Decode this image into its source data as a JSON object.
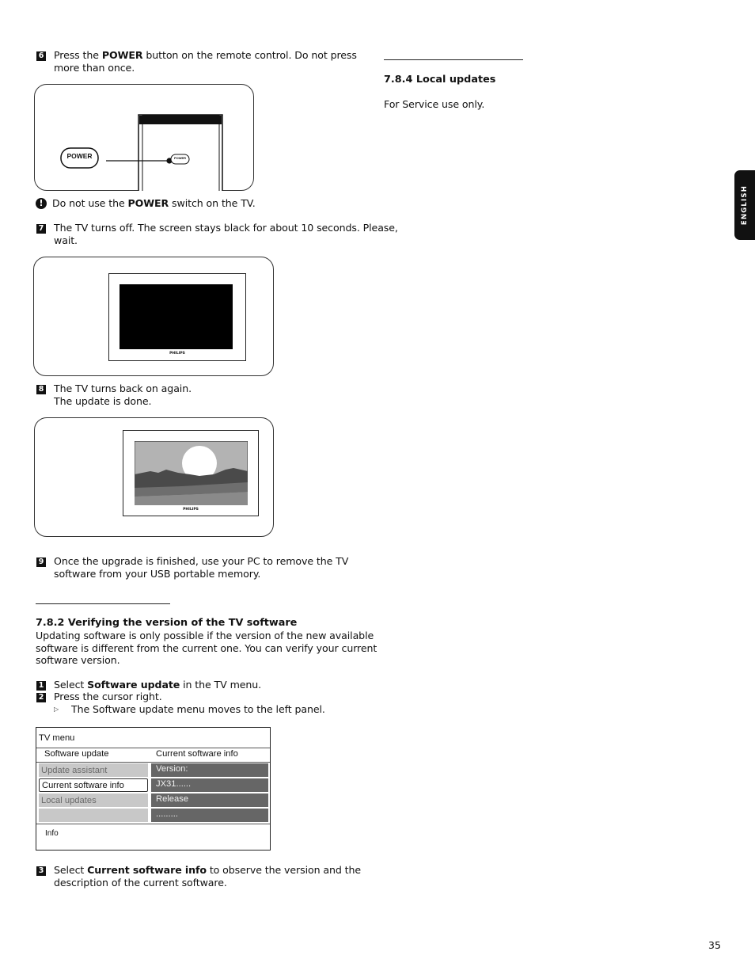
{
  "page_number": "35",
  "side_tab": "ENGLISH",
  "left_column": {
    "step6": {
      "number": "6",
      "text_pre": "Press the ",
      "bold": "POWER",
      "text_post": " button on the remote control. Do not press",
      "line2": "more than once."
    },
    "illustration_remote": {
      "remote_button_label": "POWER",
      "tv_button_label": "POWER"
    },
    "warning": {
      "icon": "exclamation-circle-icon",
      "text_pre": "Do not use the ",
      "bold": "POWER",
      "text_post": " switch on the TV."
    },
    "step7": {
      "number": "7",
      "line1": "The TV turns off. The screen stays black for about 10 seconds. Please,",
      "line2": "wait."
    },
    "illustration_tv_off": {
      "brand": "PHILIPS"
    },
    "step8": {
      "number": "8",
      "line1": "The TV turns back on again.",
      "line2": "The update is done."
    },
    "illustration_tv_on": {
      "brand": "PHILIPS"
    },
    "step9": {
      "number": "9",
      "line1": "Once the upgrade is finished, use your PC to remove the TV",
      "line2": "software from your USB portable memory."
    },
    "section_782": {
      "heading": "7.8.2  Verifying the version of the TV software",
      "para_lines": [
        "Updating software is only possible if the version of the new available",
        "software is different from the current one. You can verify your current",
        "software version."
      ]
    },
    "step1": {
      "number": "1",
      "text_pre": "Select ",
      "bold": "Software update",
      "text_post": " in the TV menu."
    },
    "step2": {
      "number": "2",
      "text": "Press the cursor right."
    },
    "step2_result": {
      "icon": "triangle-right-icon",
      "text": "The Software update menu moves to the left panel."
    },
    "tv_menu": {
      "title": "TV menu",
      "left_header": "Software update",
      "right_header": "Current software info",
      "left_items": [
        "Update assistant",
        "Current software info",
        "Local updates",
        ""
      ],
      "selected_index": 1,
      "right_items": [
        "Version:",
        "JX31......",
        "Release",
        "........."
      ],
      "info_label": "Info"
    },
    "step3": {
      "number": "3",
      "text_pre": "Select ",
      "bold": "Current software info",
      "text_post": " to observe the version and the",
      "line2": "description of the current software."
    }
  },
  "right_column": {
    "section_784": {
      "heading": "7.8.4  Local updates",
      "text": "For Service use only."
    }
  }
}
